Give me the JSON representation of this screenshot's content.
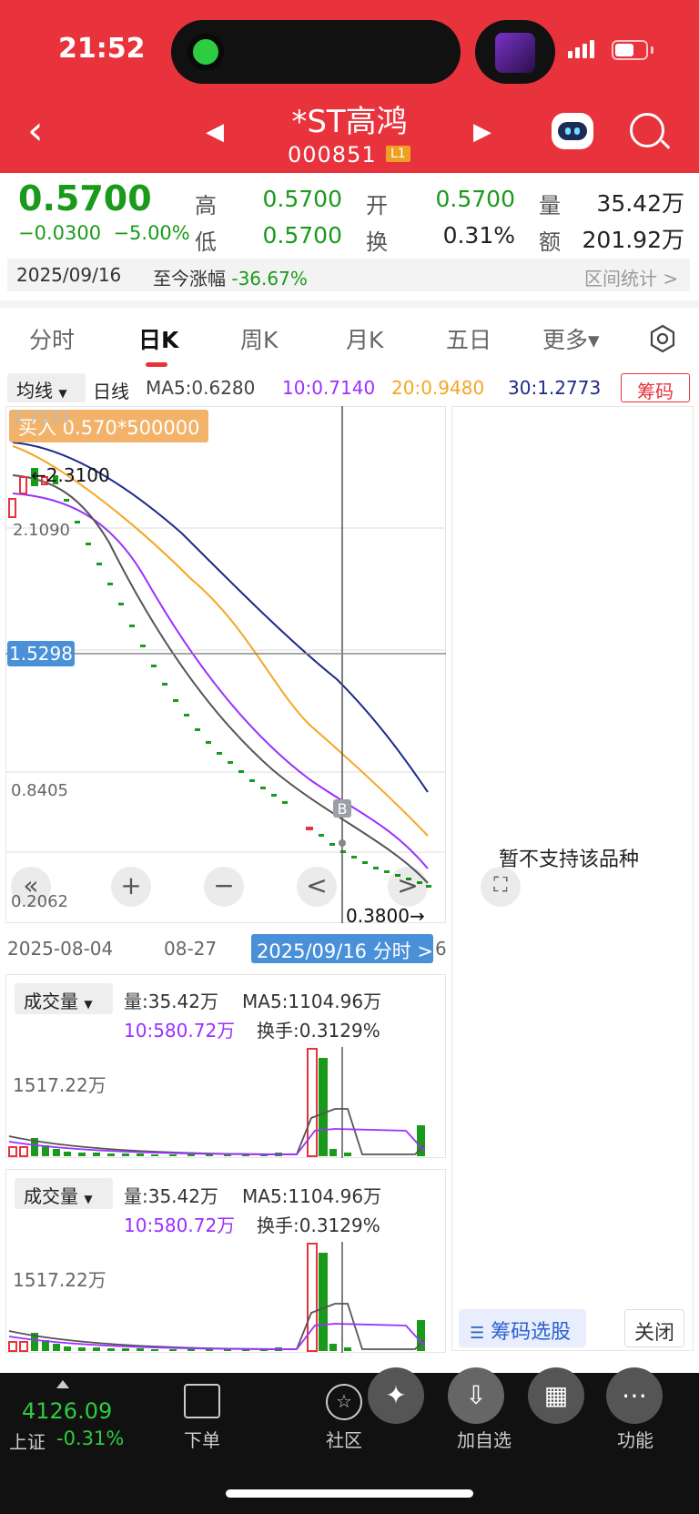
{
  "status_bar": {
    "time": "21:52"
  },
  "header": {
    "stock_name": "*ST高鸿",
    "stock_code": "000851",
    "level_badge": "L1",
    "back_icon": "chevron-left-icon",
    "prev_icon": "triangle-left-icon",
    "next_icon": "triangle-right-icon",
    "robot_icon": "robot-assistant-icon",
    "search_icon": "search-icon",
    "bg_color": "#e8323c"
  },
  "quote": {
    "price": "0.5700",
    "change": "−0.0300",
    "change_pct": "−5.00%",
    "high_label": "高",
    "high": "0.5700",
    "open_label": "开",
    "open": "0.5700",
    "volume_label": "量",
    "volume": "35.42万",
    "low_label": "低",
    "low": "0.5700",
    "turnover_label": "换",
    "turnover": "0.31%",
    "amount_label": "额",
    "amount": "201.92万",
    "date": "2025/09/16",
    "since_label": "至今涨幅",
    "since_value": "-36.67%",
    "range_stats": "区间统计 >"
  },
  "tabs": [
    "分时",
    "日K",
    "周K",
    "月K",
    "五日",
    "更多▾"
  ],
  "active_tab": "日K",
  "ma_row": {
    "selector": "均线",
    "period": "日线",
    "ma5": "MA5:0.6280",
    "ma10": "10:0.7140",
    "ma20": "20:0.9480",
    "ma30": "30:1.2773",
    "chips_button": "筹码",
    "colors": {
      "ma5": "#555555",
      "ma10": "#9b30ff",
      "ma20": "#f5a623",
      "ma30": "#1e2a8a"
    }
  },
  "kline": {
    "buy_note": "买入 0.570*500000",
    "max_label": "←2.3100",
    "top_tick": "2.7133",
    "tick_2109": "2.1090",
    "cursor_price": "1.5298",
    "tick_08405": "0.8405",
    "bottom_tick": "0.2062",
    "min_label": "0.3800→",
    "b_marker": "B",
    "date_start": "2025-08-04",
    "date_mid": "08-27",
    "date_cursor": "2025/09/16 分时 >",
    "date_end_fragment": "6",
    "unsupported": "暂不支持该品种",
    "controls": [
      "«",
      "+",
      "−",
      "<",
      ">"
    ],
    "expand_icon": "expand-icon"
  },
  "chart_data": {
    "type": "line",
    "x": [
      "2025-08-04",
      "2025-08-27",
      "2025-09-16"
    ],
    "ylim": [
      0.2062,
      2.7133
    ],
    "ticks": [
      0.2062,
      0.8405,
      2.109,
      2.7133
    ],
    "series": [
      {
        "name": "MA5",
        "values": [
          2.35,
          1.6,
          0.628
        ]
      },
      {
        "name": "10",
        "values": [
          2.3,
          1.8,
          0.714
        ]
      },
      {
        "name": "20",
        "values": [
          2.55,
          2.0,
          0.948
        ]
      },
      {
        "name": "30",
        "values": [
          2.65,
          2.2,
          1.2773
        ]
      }
    ]
  },
  "volume_panels": [
    {
      "selector": "成交量",
      "vol": "量:35.42万",
      "ma5": "MA5:1104.96万",
      "ma10": "10:580.72万",
      "turn": "换手:0.3129%",
      "tick": "1517.22万"
    },
    {
      "selector": "成交量",
      "vol": "量:35.42万",
      "ma5": "MA5:1104.96万",
      "ma10": "10:580.72万",
      "turn": "换手:0.3129%",
      "tick": "1517.22万"
    }
  ],
  "chip_panel": {
    "select_button": "筹码选股",
    "close_button": "关闭"
  },
  "bottom_bar": {
    "index_value": "4126.09",
    "index_name": "上证",
    "index_change": "-0.31%",
    "order_label": "下单",
    "community_label": "社区",
    "watchlist_label": "加自选",
    "function_label": "功能"
  }
}
